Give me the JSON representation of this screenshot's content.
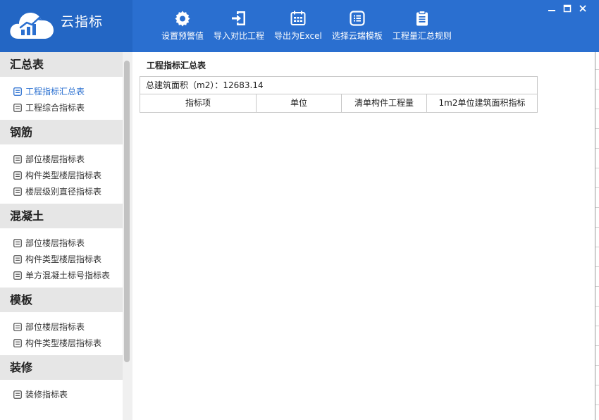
{
  "app": {
    "title": "云指标"
  },
  "toolbar": {
    "items": [
      {
        "label": "设置预警值",
        "icon": "gear-icon"
      },
      {
        "label": "导入对比工程",
        "icon": "import-icon"
      },
      {
        "label": "导出为Excel",
        "icon": "excel-export-icon"
      },
      {
        "label": "选择云端模板",
        "icon": "template-icon"
      },
      {
        "label": "工程量汇总规则",
        "icon": "clipboard-icon"
      }
    ]
  },
  "sidebar": {
    "sections": [
      {
        "title": "汇总表",
        "items": [
          "工程指标汇总表",
          "工程综合指标表"
        ]
      },
      {
        "title": "钢筋",
        "items": [
          "部位楼层指标表",
          "构件类型楼层指标表",
          "楼层级别直径指标表"
        ]
      },
      {
        "title": "混凝土",
        "items": [
          "部位楼层指标表",
          "构件类型楼层指标表",
          "单方混凝土标号指标表"
        ]
      },
      {
        "title": "模板",
        "items": [
          "部位楼层指标表",
          "构件类型楼层指标表"
        ]
      },
      {
        "title": "装修",
        "items": [
          "装修指标表"
        ]
      }
    ],
    "active_item": "工程指标汇总表"
  },
  "main": {
    "title": "工程指标汇总表",
    "area_label": "总建筑面积（m2）：12683.14",
    "columns": [
      "指标项",
      "单位",
      "清单构件工程量",
      "1m2单位建筑面积指标"
    ]
  },
  "colors": {
    "header_bg": "#2a6fd0",
    "accent": "#2a6fd0",
    "section_bg": "#e6e6e6"
  }
}
